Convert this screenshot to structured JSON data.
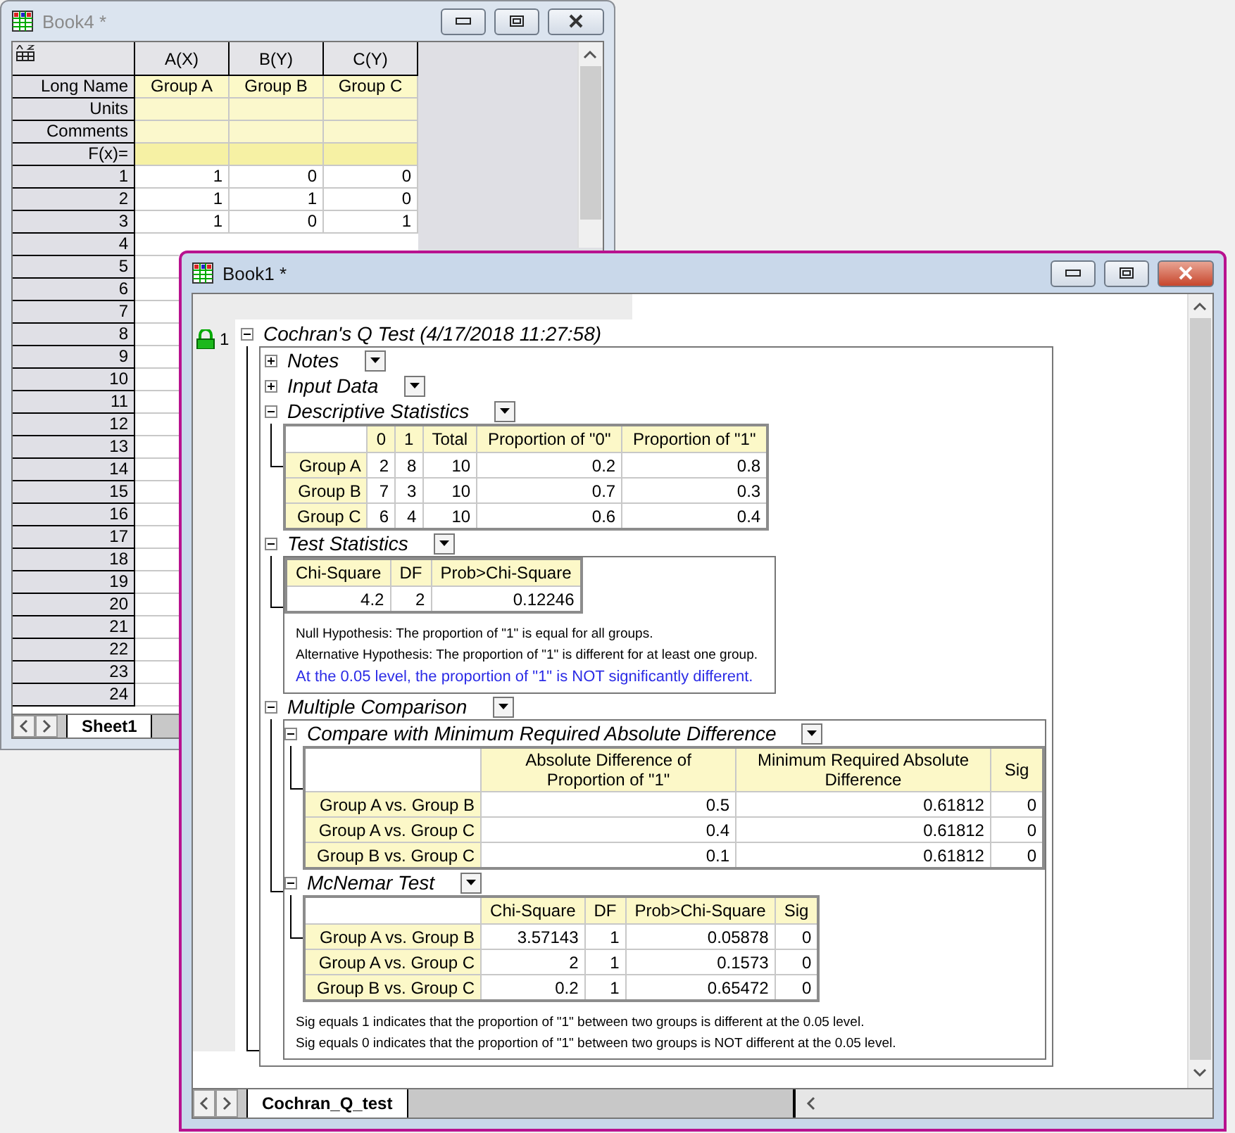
{
  "book4": {
    "title": "Book4 *",
    "active": false,
    "columns": [
      {
        "label": "A(X)",
        "long_name": "Group A"
      },
      {
        "label": "B(Y)",
        "long_name": "Group B"
      },
      {
        "label": "C(Y)",
        "long_name": "Group C"
      }
    ],
    "header_rows": [
      "Long Name",
      "Units",
      "Comments",
      "F(x)="
    ],
    "rows": [
      {
        "label": "1",
        "values": [
          "1",
          "0",
          "0"
        ]
      },
      {
        "label": "2",
        "values": [
          "1",
          "1",
          "0"
        ]
      },
      {
        "label": "3",
        "values": [
          "1",
          "0",
          "1"
        ]
      },
      {
        "label": "4"
      },
      {
        "label": "5"
      },
      {
        "label": "6"
      },
      {
        "label": "7"
      },
      {
        "label": "8"
      },
      {
        "label": "9"
      },
      {
        "label": "10"
      },
      {
        "label": "11"
      },
      {
        "label": "12"
      },
      {
        "label": "13"
      },
      {
        "label": "14"
      },
      {
        "label": "15"
      },
      {
        "label": "16"
      },
      {
        "label": "17"
      },
      {
        "label": "18"
      },
      {
        "label": "19"
      },
      {
        "label": "20"
      },
      {
        "label": "21"
      },
      {
        "label": "22"
      },
      {
        "label": "23"
      },
      {
        "label": "24"
      }
    ],
    "sheet_tab": "Sheet1"
  },
  "book1": {
    "title": "Book1 *",
    "active": true,
    "sheet_tab": "Cochran_Q_test",
    "report": {
      "index": "1",
      "title": "Cochran's Q Test (4/17/2018 11:27:58)",
      "expanded": true,
      "sections": [
        {
          "title": "Notes",
          "expanded": false
        },
        {
          "title": "Input Data",
          "expanded": false
        },
        {
          "title": "Descriptive Statistics",
          "expanded": true,
          "table": {
            "columns": [
              "0",
              "1",
              "Total",
              "Proportion of \"0\"",
              "Proportion of \"1\""
            ],
            "rows": [
              {
                "label": "Group A",
                "cells": [
                  "2",
                  "8",
                  "10",
                  "0.2",
                  "0.8"
                ]
              },
              {
                "label": "Group B",
                "cells": [
                  "7",
                  "3",
                  "10",
                  "0.7",
                  "0.3"
                ]
              },
              {
                "label": "Group C",
                "cells": [
                  "6",
                  "4",
                  "10",
                  "0.6",
                  "0.4"
                ]
              }
            ]
          }
        },
        {
          "title": "Test Statistics",
          "expanded": true,
          "table": {
            "columns": [
              "Chi-Square",
              "DF",
              "Prob>Chi-Square"
            ],
            "rows": [
              {
                "cells": [
                  "4.2",
                  "2",
                  "0.12246"
                ]
              }
            ]
          },
          "notes": [
            {
              "kind": "plain",
              "text": "Null Hypothesis: The proportion of \"1\" is equal for all groups."
            },
            {
              "kind": "plain",
              "text": "Alternative Hypothesis: The proportion of \"1\" is different for at least one group."
            },
            {
              "kind": "conclusion",
              "text": "At the 0.05 level, the proportion of \"1\" is NOT significantly different."
            }
          ]
        },
        {
          "title": "Multiple Comparison",
          "expanded": true,
          "children": [
            {
              "title": "Compare with Minimum Required Absolute Difference",
              "expanded": true,
              "table": {
                "columns": [
                  "Absolute Difference of Proportion of \"1\"",
                  "Minimum Required Absolute Difference",
                  "Sig"
                ],
                "rows": [
                  {
                    "label": "Group A vs. Group B",
                    "cells": [
                      "0.5",
                      "0.61812",
                      "0"
                    ]
                  },
                  {
                    "label": "Group A vs. Group C",
                    "cells": [
                      "0.4",
                      "0.61812",
                      "0"
                    ]
                  },
                  {
                    "label": "Group B vs. Group C",
                    "cells": [
                      "0.1",
                      "0.61812",
                      "0"
                    ]
                  }
                ]
              }
            },
            {
              "title": "McNemar Test",
              "expanded": true,
              "table": {
                "columns": [
                  "Chi-Square",
                  "DF",
                  "Prob>Chi-Square",
                  "Sig"
                ],
                "rows": [
                  {
                    "label": "Group A vs. Group B",
                    "cells": [
                      "3.57143",
                      "1",
                      "0.05878",
                      "0"
                    ]
                  },
                  {
                    "label": "Group A vs. Group C",
                    "cells": [
                      "2",
                      "1",
                      "0.1573",
                      "0"
                    ]
                  },
                  {
                    "label": "Group B vs. Group C",
                    "cells": [
                      "0.2",
                      "1",
                      "0.65472",
                      "0"
                    ]
                  }
                ]
              }
            }
          ],
          "notes": [
            {
              "kind": "plain",
              "text": "Sig equals 1 indicates that the proportion of \"1\" between two groups is different at the 0.05 level."
            },
            {
              "kind": "plain",
              "text": "Sig equals 0 indicates that the proportion of \"1\" between two groups is NOT different at the 0.05 level."
            }
          ]
        }
      ]
    }
  }
}
